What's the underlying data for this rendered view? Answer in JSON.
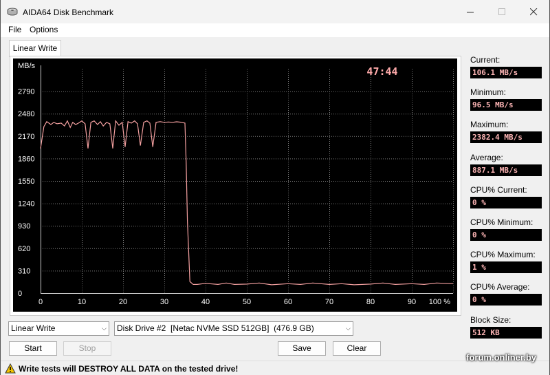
{
  "window": {
    "title": "AIDA64 Disk Benchmark"
  },
  "menu": [
    "File",
    "Options"
  ],
  "tab": {
    "label": "Linear Write"
  },
  "chart_data": {
    "type": "line",
    "ylabel": "MB/s",
    "elapsed_time": "47:44",
    "y_ticks": [
      "2790",
      "2480",
      "2170",
      "1860",
      "1550",
      "1240",
      "930",
      "620",
      "310",
      "0"
    ],
    "x_ticks": [
      "0",
      "10",
      "20",
      "30",
      "40",
      "50",
      "60",
      "70",
      "80",
      "90",
      "100 %"
    ],
    "xlim": [
      0,
      100
    ],
    "ylim": [
      0,
      3100
    ],
    "grid": true,
    "background": "#000000",
    "line_color": "#f4a0a0",
    "time_color": "#ffaaaa",
    "series": [
      {
        "x": [
          0,
          0.8,
          1.5,
          2.5,
          3.2,
          4,
          5,
          5.8,
          6.5,
          7.2,
          7.8,
          8.5,
          9.2,
          10,
          10.8,
          11.5,
          12.2,
          13,
          13.8,
          14.5,
          15.2,
          16,
          16.8,
          17.5,
          18.2,
          19,
          19.8,
          20.5,
          21.2,
          22,
          22.8,
          23.5,
          24.2,
          25,
          25.8,
          26.5,
          27.2,
          28,
          29,
          30,
          31,
          32,
          33,
          34,
          35,
          35.3,
          35.6,
          36.2,
          37,
          38,
          40,
          43,
          45,
          47,
          50,
          53,
          56,
          60,
          63,
          66,
          70,
          73,
          76,
          80,
          83,
          86,
          90,
          93,
          96,
          100
        ],
        "y": [
          2000,
          2300,
          2370,
          2330,
          2360,
          2340,
          2350,
          2310,
          2380,
          2290,
          2360,
          2330,
          2350,
          2380,
          2340,
          2000,
          2360,
          2380,
          2330,
          2370,
          2310,
          2360,
          2340,
          2000,
          2380,
          2320,
          2360,
          2020,
          2370,
          2350,
          2380,
          2340,
          2040,
          2360,
          2380,
          2350,
          2020,
          2360,
          2370,
          2360,
          2365,
          2360,
          2368,
          2362,
          2350,
          1800,
          1000,
          160,
          120,
          120,
          135,
          120,
          140,
          120,
          125,
          140,
          115,
          130,
          120,
          140,
          120,
          130,
          115,
          125,
          140,
          120,
          130,
          120,
          140,
          130
        ]
      }
    ]
  },
  "stats": [
    {
      "label": "Current:",
      "value": "106.1 MB/s"
    },
    {
      "label": "Minimum:",
      "value": "96.5 MB/s"
    },
    {
      "label": "Maximum:",
      "value": "2382.4 MB/s"
    },
    {
      "label": "Average:",
      "value": "887.1 MB/s"
    },
    {
      "label": "CPU% Current:",
      "value": "0 %"
    },
    {
      "label": "CPU% Minimum:",
      "value": "0 %"
    },
    {
      "label": "CPU% Maximum:",
      "value": "1 %"
    },
    {
      "label": "CPU% Average:",
      "value": "0 %"
    },
    {
      "label": "Block Size:",
      "value": "512 KB"
    }
  ],
  "controls": {
    "test_select": "Linear Write",
    "drive_select": "Disk Drive #2  [Netac NVMe SSD 512GB]  (476.9 GB)",
    "start": "Start",
    "stop": "Stop",
    "save": "Save",
    "clear": "Clear"
  },
  "status": {
    "warning": "Write tests will DESTROY ALL DATA on the tested drive!"
  },
  "watermark": "forum.onliner.by"
}
